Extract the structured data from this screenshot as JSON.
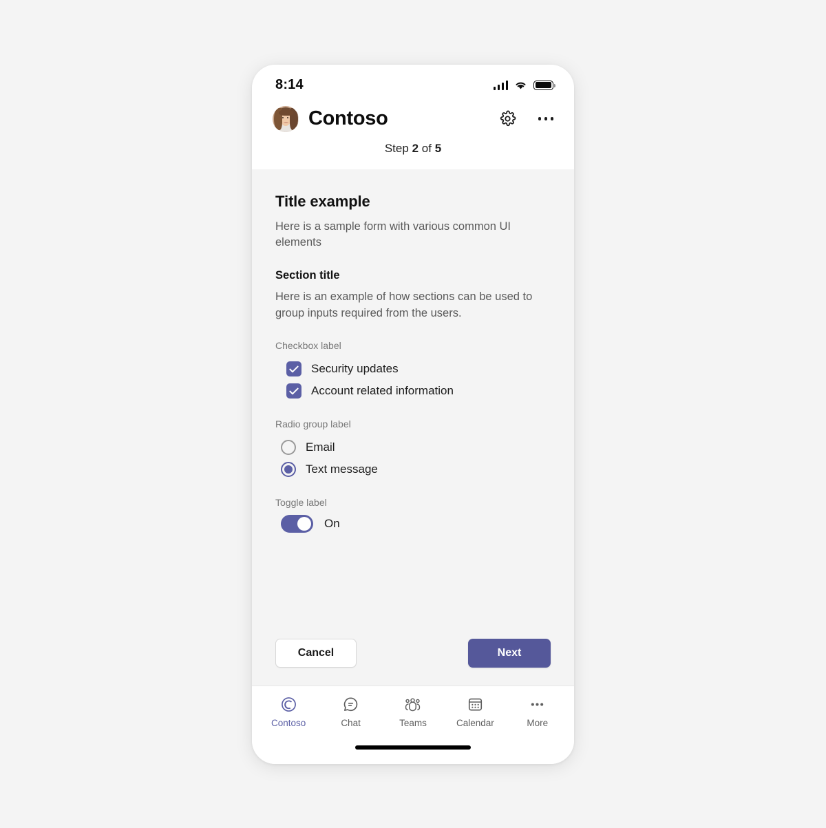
{
  "status_bar": {
    "time": "8:14",
    "signal_icon": "cellular-signal-icon",
    "wifi_icon": "wifi-icon",
    "battery_icon": "battery-full-icon"
  },
  "app_bar": {
    "avatar_name": "user-avatar",
    "title": "Contoso",
    "settings_icon": "gear-icon",
    "overflow_icon": "more-horizontal-icon"
  },
  "step_indicator": {
    "prefix": "Step",
    "current": "2",
    "middle": "of",
    "total": "5"
  },
  "form": {
    "title": "Title example",
    "description": "Here is a sample form with various common UI elements",
    "section_title": "Section title",
    "section_description": "Here is an example of how sections can be used to group inputs required from the users.",
    "checkbox_group": {
      "label": "Checkbox label",
      "options": [
        {
          "label": "Security updates",
          "checked": true
        },
        {
          "label": "Account related information",
          "checked": true
        }
      ]
    },
    "radio_group": {
      "label": "Radio group label",
      "options": [
        {
          "label": "Email",
          "selected": false
        },
        {
          "label": "Text message",
          "selected": true
        }
      ]
    },
    "toggle": {
      "label": "Toggle label",
      "state_text": "On",
      "on": true
    }
  },
  "actions": {
    "cancel_label": "Cancel",
    "next_label": "Next"
  },
  "tab_bar": {
    "tabs": [
      {
        "label": "Contoso",
        "icon": "contoso-spiral-icon",
        "active": true
      },
      {
        "label": "Chat",
        "icon": "chat-bubble-icon",
        "active": false
      },
      {
        "label": "Teams",
        "icon": "people-team-icon",
        "active": false
      },
      {
        "label": "Calendar",
        "icon": "calendar-icon",
        "active": false
      },
      {
        "label": "More",
        "icon": "more-horizontal-icon",
        "active": false
      }
    ]
  },
  "colors": {
    "accent_purple": "#5b5fa5",
    "primary_button": "#55589a",
    "body_background": "#f4f4f4",
    "surface": "#ffffff",
    "muted_text": "#777777"
  }
}
